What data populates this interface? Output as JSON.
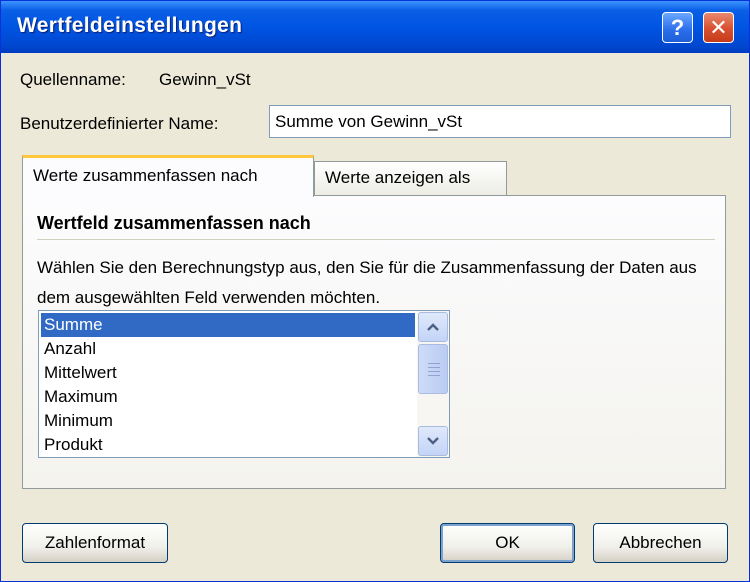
{
  "window": {
    "title": "Wertfeldeinstellungen"
  },
  "titlebar": {
    "help_glyph": "?",
    "close_glyph": "✕"
  },
  "source": {
    "label": "Quellenname:",
    "value": "Gewinn_vSt"
  },
  "custom_name": {
    "label": "Benutzerdefinierter Name:",
    "value": "Summe von Gewinn_vSt"
  },
  "tabs": [
    {
      "label": "Werte zusammenfassen nach",
      "active": true
    },
    {
      "label": "Werte anzeigen als",
      "active": false
    }
  ],
  "panel": {
    "title": "Wertfeld zusammenfassen nach",
    "description": "Wählen Sie den Berechnungstyp aus, den Sie für die Zusammenfassung der Daten aus dem ausgewählten Feld verwenden möchten."
  },
  "list": {
    "items": [
      "Summe",
      "Anzahl",
      "Mittelwert",
      "Maximum",
      "Minimum",
      "Produkt"
    ],
    "selected": "Summe"
  },
  "scroll": {
    "up_glyph": "︿",
    "down_glyph": "﹀"
  },
  "buttons": {
    "number_format": "Zahlenformat",
    "ok": "OK",
    "cancel": "Abbrechen"
  },
  "colors": {
    "title_bar": "#0054E3",
    "selection": "#316AC5",
    "active_tab_accent": "#FFC83C",
    "close": "#D8502F"
  },
  "icons": [
    "help-icon",
    "close-icon",
    "scroll-up-icon",
    "scroll-down-icon"
  ]
}
